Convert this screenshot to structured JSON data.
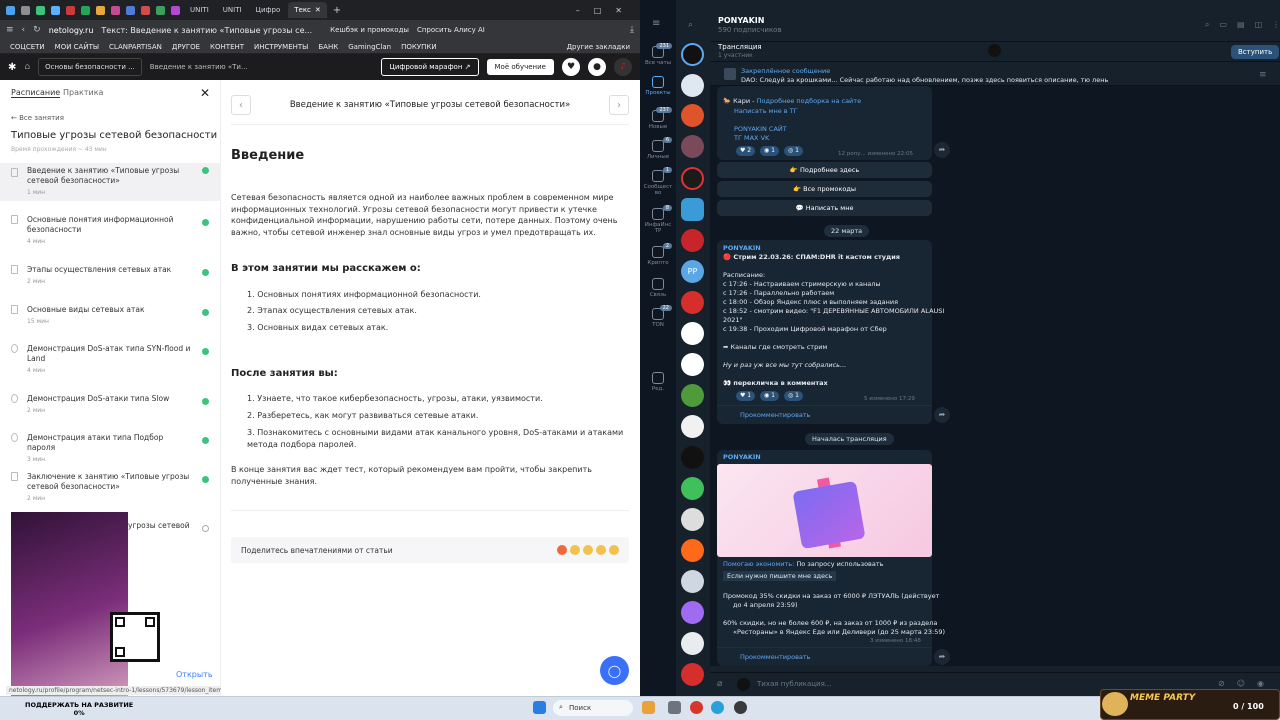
{
  "browser": {
    "tabs": [
      {
        "label": "UNITI"
      },
      {
        "label": "UNITI"
      },
      {
        "label": "Цифро"
      },
      {
        "label": "Текс"
      }
    ],
    "address": {
      "url": "netology.ru",
      "page_title": "Текст: Введение к занятию «Типовые угрозы се...",
      "cashback": "Кешбэк и промокоды",
      "alice": "Спросить Алису AI"
    },
    "bookmarks": [
      "СОЦСЕТИ",
      "МОИ САЙТЫ",
      "CLANPARTISAN",
      "ДРУГОЕ",
      "КОНТЕНТ",
      "ИНСТРУМЕНТЫ",
      "БАНК",
      "GamingClan",
      "ПОКУПКИ"
    ],
    "bookmarks_other": "Другие закладки",
    "status_url": "netology.ru/profile/program/netsec-intro-1/lessons/573679/lesson_items/3096022"
  },
  "site": {
    "crumb_box": "Основы безопасности ...",
    "crumb": "Введение к занятию «Ти...",
    "marathon_button": "Цифровой марафон",
    "learning_button": "Моё обучение"
  },
  "sidebar": {
    "tab_schedule": "Расписание",
    "tab_practice": "Практика",
    "back": "Все занятия",
    "course_title": "Типовые угрозы сетевой безопасности",
    "total_time": "Время прохождения ~ 43 мин",
    "lessons": [
      {
        "title": "Введение к занятию «Типовые угрозы сетевой безопасности»",
        "time": "1 мин",
        "done": true
      },
      {
        "title": "Основные понятия информационной безопасности",
        "time": "4 мин",
        "done": true
      },
      {
        "title": "Этапы осуществления сетевых атак",
        "time": "2 мин",
        "done": true
      },
      {
        "title": "Основные виды сетевых атак",
        "time": "15 мин",
        "done": true
      },
      {
        "title": "Демонстрация DoS-атак типа SYN-flood и Land",
        "time": "4 мин",
        "done": true
      },
      {
        "title": "Демонстрация DoS-атаки типа Slow",
        "time": "2 мин",
        "done": true
      },
      {
        "title": "Демонстрация атаки типа Подбор пароля",
        "time": "3 мин",
        "done": true
      },
      {
        "title": "Заключение к занятию «Типовые угрозы сетевой безопасности»",
        "time": "2 мин",
        "done": true
      },
      {
        "title": "угрозы сетевой",
        "time": "",
        "done": false
      }
    ],
    "open_link": "Открыть"
  },
  "article": {
    "nav_title": "Введение к занятию «Типовые угрозы сетевой безопасности»",
    "heading": "Введение",
    "intro": "Сетевая безопасность является одной из наиболее важных проблем в современном мире информационных технологий. Угрозы сетевой безопасности могут привести к утечке конфиденциальной информации, нарушению работы сети, потере данных. Поэтому очень важно, чтобы сетевой инженер знал основные виды угроз и умел предотвращать их.",
    "learn_heading": "В этом занятии мы расскажем о:",
    "learn_items": [
      "Основных понятиях информационной безопасности.",
      "Этапах осуществления сетевых атак.",
      "Основных видах сетевых атак."
    ],
    "after_heading": "После занятия вы:",
    "after_items": [
      "Узнаете, что такое кибербезопасность, угрозы, атаки, уязвимости.",
      "Разберетесь, как могут развиваться сетевые атаки.",
      "Познакомитесь с основными видами атак канального уровня, DoS-атаками и атаками метода подбора паролей."
    ],
    "test_text": "В конце занятия вас ждет тест, который рекомендуем вам пройти, чтобы закрепить полученные знания.",
    "feedback": "Поделитесь впечатлениями от статьи"
  },
  "telegram": {
    "rail": [
      {
        "label": "Все чаты",
        "badge": "231"
      },
      {
        "label": "Проекты",
        "badge": ""
      },
      {
        "label": "Новые",
        "badge": "237"
      },
      {
        "label": "Личные",
        "badge": "6"
      },
      {
        "label": "Сообщест во",
        "badge": "1"
      },
      {
        "label": "ИнфаИнс ТР",
        "badge": "8"
      },
      {
        "label": "Крипто",
        "badge": "2"
      },
      {
        "label": "Связь",
        "badge": ""
      },
      {
        "label": "TON",
        "badge": "22"
      },
      {
        "label": "Ред.",
        "badge": ""
      }
    ],
    "channel_name": "PONYAKIN",
    "subscribers": "590 подписчиков",
    "live_title": "Трансляция",
    "live_sub": "1 участник",
    "join": "Вступить",
    "pinned_title": "Закреплённое сообщение",
    "pinned_text": "DAO: Следуй за крошками... Сейчас работаю над обновлением, позже здесь появиться описание, тю лень",
    "msg1": {
      "line1a": "Кари - ",
      "line1b": "Подробнее подборка на сайте",
      "line2": "Написать мне в ТГ",
      "line3": "PONYAKIN САЙТ",
      "line4": "ТГ  MAX  VK",
      "reactions": [
        "2",
        "1",
        "1"
      ],
      "meta": "12  ропу...  изменено 22:05"
    },
    "buttons": [
      "Подробнее здесь",
      "Все промокоды",
      "Написать мне"
    ],
    "date1": "22 марта",
    "msg2": {
      "author": "PONYAKIN",
      "title": "Стрим 22.03.26: СПАМ:DHR it кастом студия",
      "sched_label": "Расписание:",
      "sched": [
        "с 17:26 - Настраиваем стримерскую и каналы",
        "с 17:26 - Параллельно работаем",
        "с 18:00 - Обзор Яндекс плюс и выполняем задания",
        "с 18:52 - смотрим видео: \"F1 ДЕРЕВЯННЫЕ АВТОМОБИЛИ ALAUSI",
        "2021\"",
        "с 19:38 - Проходим Цифровой марафон от Сбер"
      ],
      "channels": "Каналы где смотреть стрим",
      "italic": "Ну и раз уж все мы тут собрались...",
      "roll": "перекличка в комментах",
      "reactions": [
        "1",
        "1",
        "1"
      ],
      "meta": "5  изменено 17:29",
      "comment": "Прокомментировать"
    },
    "date2": "Началась трансляция",
    "msg3": {
      "author": "PONYAKIN",
      "l1a": "Помогаю экономить:",
      "l1b": "По запросу использовать",
      "l2": "Если нужно пишите мне здесь",
      "l3": "Промокод 35% скидки на заказ от 6000 ₽ ЛЭТУАЛЬ (действует",
      "l4": "до 4 апреля 23:59)",
      "l5": "60% скидки, но не более 600 ₽, на заказ от 1000 ₽ из раздела",
      "l6": "«Рестораны» в Яндекс Еде или Деливери (до 25 марта 23:59)",
      "meta": "3  изменено 18:48",
      "comment": "Прокомментировать"
    },
    "compose_placeholder": "Тихая публикация..."
  },
  "taskbar": {
    "donate_l1": "ПОДДЕРЖАТЬ НА РАЗВИТИЕ",
    "donate_l2": "0%",
    "search": "Поиск",
    "meme_title": "MEME PARTY",
    "meme_progress": "0 / 100"
  }
}
